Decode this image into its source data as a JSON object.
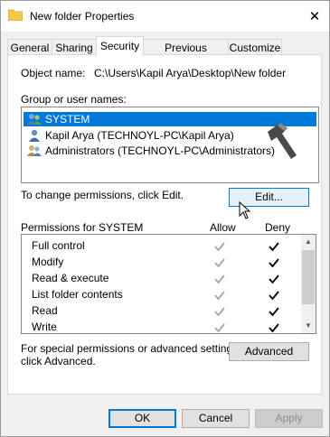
{
  "window": {
    "title": "New folder Properties",
    "close_glyph": "✕"
  },
  "tabs": [
    {
      "label": "General"
    },
    {
      "label": "Sharing"
    },
    {
      "label": "Security"
    },
    {
      "label": "Previous Versions"
    },
    {
      "label": "Customize"
    }
  ],
  "object": {
    "label": "Object name:",
    "value": "C:\\Users\\Kapil Arya\\Desktop\\New folder"
  },
  "groups": {
    "label": "Group or user names:",
    "items": [
      {
        "name": "SYSTEM",
        "icon": "users-icon",
        "selected": true
      },
      {
        "name": "Kapil Arya (TECHNOYL-PC\\Kapil Arya)",
        "icon": "user-icon",
        "selected": false
      },
      {
        "name": "Administrators (TECHNOYL-PC\\Administrators)",
        "icon": "users-icon",
        "selected": false
      }
    ]
  },
  "change_text": "To change permissions, click Edit.",
  "edit_button": "Edit...",
  "permissions": {
    "header": "Permissions for SYSTEM",
    "allow_label": "Allow",
    "deny_label": "Deny",
    "rows": [
      {
        "name": "Full control",
        "allow": true,
        "deny": true
      },
      {
        "name": "Modify",
        "allow": true,
        "deny": true
      },
      {
        "name": "Read & execute",
        "allow": true,
        "deny": true
      },
      {
        "name": "List folder contents",
        "allow": true,
        "deny": true
      },
      {
        "name": "Read",
        "allow": true,
        "deny": true
      },
      {
        "name": "Write",
        "allow": true,
        "deny": true
      }
    ]
  },
  "special_text_1": "For special permissions or advanced settings,",
  "special_text_2": "click Advanced.",
  "advanced_button": "Advanced",
  "footer": {
    "ok": "OK",
    "cancel": "Cancel",
    "apply": "Apply"
  },
  "colors": {
    "accent": "#0078d7",
    "grey_check": "#a6a6a6"
  }
}
